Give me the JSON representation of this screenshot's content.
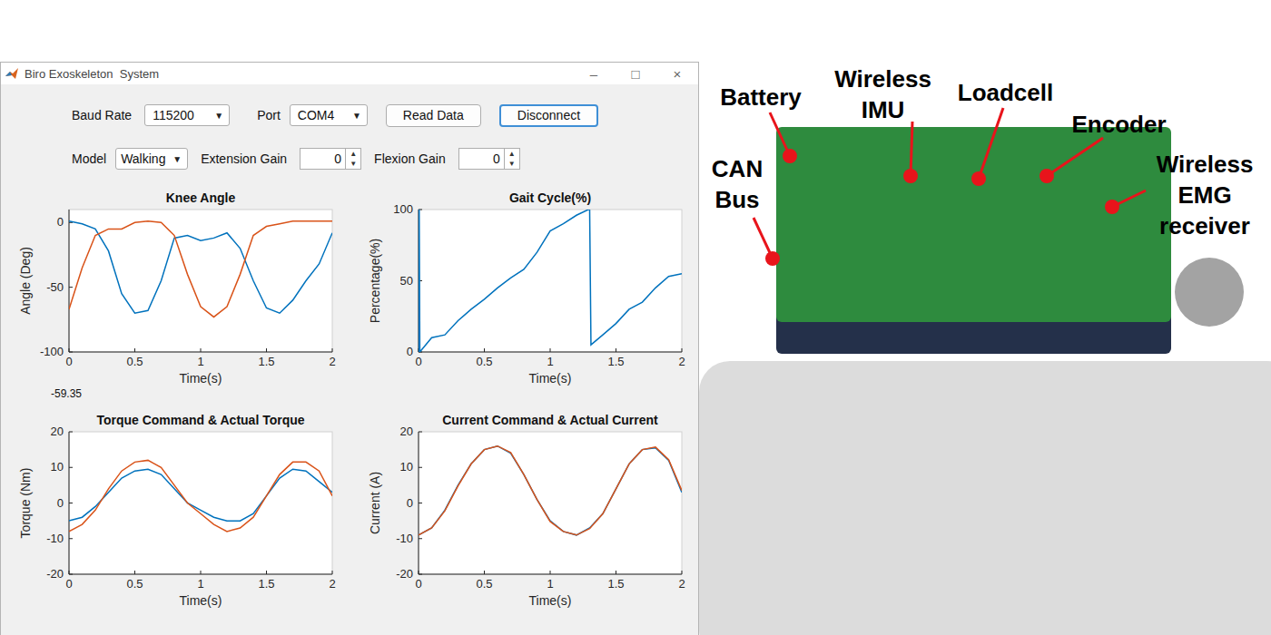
{
  "window": {
    "title": "Biro Exoskeleton  System",
    "controls": [
      "–",
      "□",
      "×"
    ]
  },
  "toolbar": {
    "baud_rate": {
      "label": "Baud Rate",
      "value": "115200",
      "caret": "▼"
    },
    "port": {
      "label": "Port",
      "value": "COM4",
      "caret": "▼"
    },
    "buttons": [
      {
        "label": "Read Data",
        "focused": false
      },
      {
        "label": "Disconnect",
        "focused": true
      }
    ]
  },
  "settings": {
    "model": {
      "label": "Model",
      "value": "Walking",
      "caret": "▼"
    },
    "gains": [
      {
        "label": "Extension Gain",
        "value": "0",
        "up": "▲",
        "down": "▼"
      },
      {
        "label": "Flexion Gain",
        "value": "0",
        "up": "▲",
        "down": "▼"
      }
    ]
  },
  "charts": [
    {
      "title": "Knee Angle",
      "y_label": "Angle (Deg)",
      "x_label": "Time(s)",
      "readout": "-59.35",
      "x_ticks": [
        "0",
        "0.5",
        "1",
        "1.5",
        "2"
      ],
      "y_ticks": [
        "0",
        "-50",
        "-100"
      ],
      "t": [
        0,
        0.1,
        0.2,
        0.3,
        0.4,
        0.5,
        0.6,
        0.7,
        0.8,
        0.9,
        1.0,
        1.1,
        1.2,
        1.3,
        1.4,
        1.5,
        1.6,
        1.7,
        1.8,
        1.9,
        2.0
      ],
      "series": [
        {
          "color": "#0072BD",
          "values": [
            1,
            -1,
            -5,
            -22,
            -55,
            -70,
            -68,
            -45,
            -12,
            -10,
            -14,
            -12,
            -8,
            -20,
            -45,
            -66,
            -70,
            -60,
            -45,
            -32,
            -8
          ]
        },
        {
          "color": "#D95319",
          "values": [
            -67,
            -35,
            -10,
            -5,
            -5,
            0,
            1,
            0,
            -10,
            -40,
            -65,
            -73,
            -65,
            -40,
            -10,
            -3,
            -1,
            1,
            1,
            1,
            1
          ]
        }
      ]
    },
    {
      "title": "Gait Cycle(%)",
      "y_label": "Percentage(%)",
      "x_label": "Time(s)",
      "readout": "",
      "x_ticks": [
        "0",
        "0.5",
        "1",
        "1.5",
        "2"
      ],
      "y_ticks": [
        "0",
        "50",
        "100"
      ],
      "t": [
        0,
        0.005,
        0.01,
        0.1,
        0.2,
        0.3,
        0.4,
        0.5,
        0.6,
        0.7,
        0.8,
        0.9,
        1.0,
        1.1,
        1.2,
        1.29,
        1.3,
        1.31,
        1.4,
        1.5,
        1.6,
        1.7,
        1.8,
        1.9,
        2.0
      ],
      "series": [
        {
          "color": "#0072BD",
          "values": [
            0,
            100,
            0,
            10,
            12,
            22,
            30,
            37,
            45,
            52,
            58,
            70,
            85,
            90,
            96,
            100,
            100,
            5,
            12,
            20,
            30,
            35,
            45,
            53,
            55
          ]
        }
      ]
    },
    {
      "title": "Torque Command & Actual Torque",
      "y_label": "Torque (Nm)",
      "x_label": "Time(s)",
      "readout": "",
      "x_ticks": [
        "0",
        "0.5",
        "1",
        "1.5",
        "2"
      ],
      "y_ticks": [
        "20",
        "10",
        "0",
        "-10",
        "-20"
      ],
      "t": [
        0,
        0.1,
        0.2,
        0.3,
        0.4,
        0.5,
        0.6,
        0.7,
        0.8,
        0.9,
        1.0,
        1.1,
        1.2,
        1.3,
        1.4,
        1.5,
        1.6,
        1.7,
        1.8,
        1.9,
        2.0
      ],
      "series": [
        {
          "color": "#0072BD",
          "values": [
            -5,
            -4,
            -1,
            3,
            7,
            9,
            9.5,
            8,
            4,
            0,
            -2,
            -4,
            -5,
            -5,
            -3,
            2,
            7,
            9.5,
            9,
            6,
            3
          ]
        },
        {
          "color": "#D95319",
          "values": [
            -8,
            -6,
            -2,
            4,
            9,
            11.5,
            12,
            10,
            5,
            0,
            -3,
            -6,
            -8,
            -7,
            -4,
            2,
            8,
            11.5,
            11.5,
            9,
            2
          ]
        }
      ]
    },
    {
      "title": "Current Command & Actual Current",
      "y_label": "Current (A)",
      "x_label": "Time(s)",
      "readout": "",
      "x_ticks": [
        "0",
        "0.5",
        "1",
        "1.5",
        "2"
      ],
      "y_ticks": [
        "20",
        "10",
        "0",
        "-10",
        "-20"
      ],
      "t": [
        0,
        0.1,
        0.2,
        0.3,
        0.4,
        0.5,
        0.6,
        0.7,
        0.8,
        0.9,
        1.0,
        1.1,
        1.2,
        1.3,
        1.4,
        1.5,
        1.6,
        1.7,
        1.8,
        1.9,
        2.0
      ],
      "series": [
        {
          "color": "#0072BD",
          "values": [
            -9,
            -7,
            -2,
            5,
            11,
            15,
            16,
            14,
            8,
            1,
            -5,
            -8,
            -9,
            -7,
            -3,
            4,
            11,
            15,
            15.5,
            12,
            3
          ]
        },
        {
          "color": "#D95319",
          "values": [
            -9,
            -7,
            -2.2,
            4.8,
            11,
            15,
            16,
            14.2,
            8,
            1,
            -5.2,
            -8,
            -9,
            -7.2,
            -3,
            4,
            11,
            15,
            15.7,
            12.2,
            3.5
          ]
        }
      ]
    }
  ],
  "photo": {
    "labels": [
      {
        "text": "Battery"
      },
      {
        "text": "Wireless IMU"
      },
      {
        "text": "Loadcell"
      },
      {
        "text": "Encoder"
      },
      {
        "text": "CAN Bus"
      },
      {
        "text": "Wireless EMG receiver"
      }
    ]
  }
}
